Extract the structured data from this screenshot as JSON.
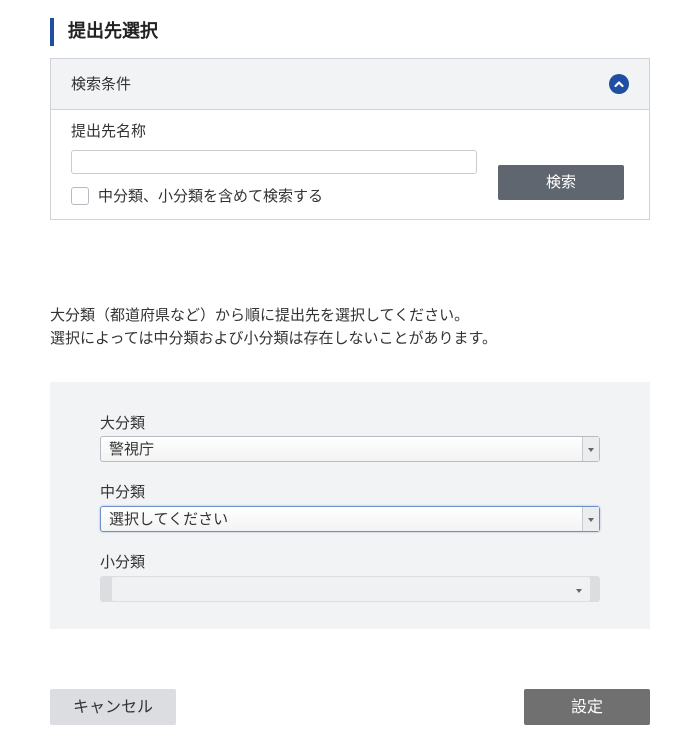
{
  "page": {
    "title": "提出先選択"
  },
  "search_panel": {
    "header_title": "検索条件",
    "collapse_icon": "chevron-up-icon",
    "name_label": "提出先名称",
    "name_value": "",
    "include_subcategories_label": "中分類、小分類を含めて検索する",
    "include_subcategories_checked": false,
    "search_button_label": "検索"
  },
  "instructions": {
    "line1": "大分類（都道府県など）から順に提出先を選択してください。",
    "line2": "選択によっては中分類および小分類は存在しないことがあります。"
  },
  "categories": {
    "major": {
      "label": "大分類",
      "selected": "警視庁"
    },
    "middle": {
      "label": "中分類",
      "selected": "選択してください"
    },
    "minor": {
      "label": "小分類",
      "selected": "",
      "disabled": true
    }
  },
  "footer": {
    "cancel_label": "キャンセル",
    "submit_label": "設定"
  },
  "colors": {
    "accent": "#1f4fa3",
    "search_button": "#5f6670",
    "submit_button": "#707070",
    "cancel_button": "#dcdde0",
    "panel_background": "#f2f3f5"
  }
}
